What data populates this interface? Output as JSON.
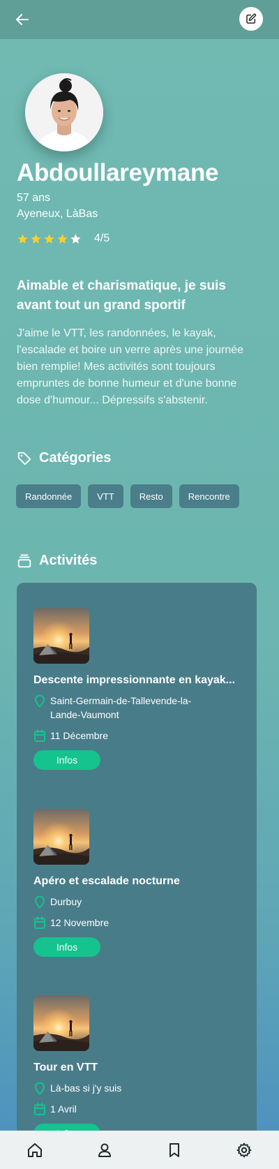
{
  "header": {
    "back_icon": "arrow-left-icon",
    "edit_icon": "edit-pencil-icon"
  },
  "profile": {
    "name": "Abdoullareymane",
    "age": "57 ans",
    "location": "Ayeneux, LàBas",
    "rating_value": 4,
    "rating_max": 5,
    "rating_text": "4/5",
    "headline": "Aimable et charismatique, je suis avant tout un grand sportif",
    "bio": "J'aime le VTT, les randonnées, le kayak, l'escalade et boire un verre après une journée bien remplie! Mes activités sont toujours empruntes de bonne humeur et d'une bonne dose d'humour... Dépressifs s'abstenir."
  },
  "categories": {
    "title": "Catégories",
    "items": [
      "Randonnée",
      "VTT",
      "Resto",
      "Rencontre"
    ]
  },
  "activities": {
    "title": "Activités",
    "items": [
      {
        "title": "Descente impressionnante en kayak...",
        "place": "Saint-Germain-de-Tallevende-la-Lande-Vaumont",
        "date": "11 Décembre",
        "button": "Infos"
      },
      {
        "title": "Apéro et escalade nocturne",
        "place": "Durbuy",
        "date": "12 Novembre",
        "button": "Infos"
      },
      {
        "title": "Tour en VTT",
        "place": "Là-bas si j'y suis",
        "date": "1 Avril",
        "button": "Infos"
      }
    ]
  },
  "colors": {
    "background": "#6cb5b0",
    "topbar": "#5f9f98",
    "chip": "#4a7e8a",
    "panel": "#497c89",
    "accent": "#14c38e",
    "star": "#f5d033"
  },
  "bottom_nav": [
    "home-icon",
    "user-icon",
    "bookmark-icon",
    "settings-gear-icon"
  ]
}
